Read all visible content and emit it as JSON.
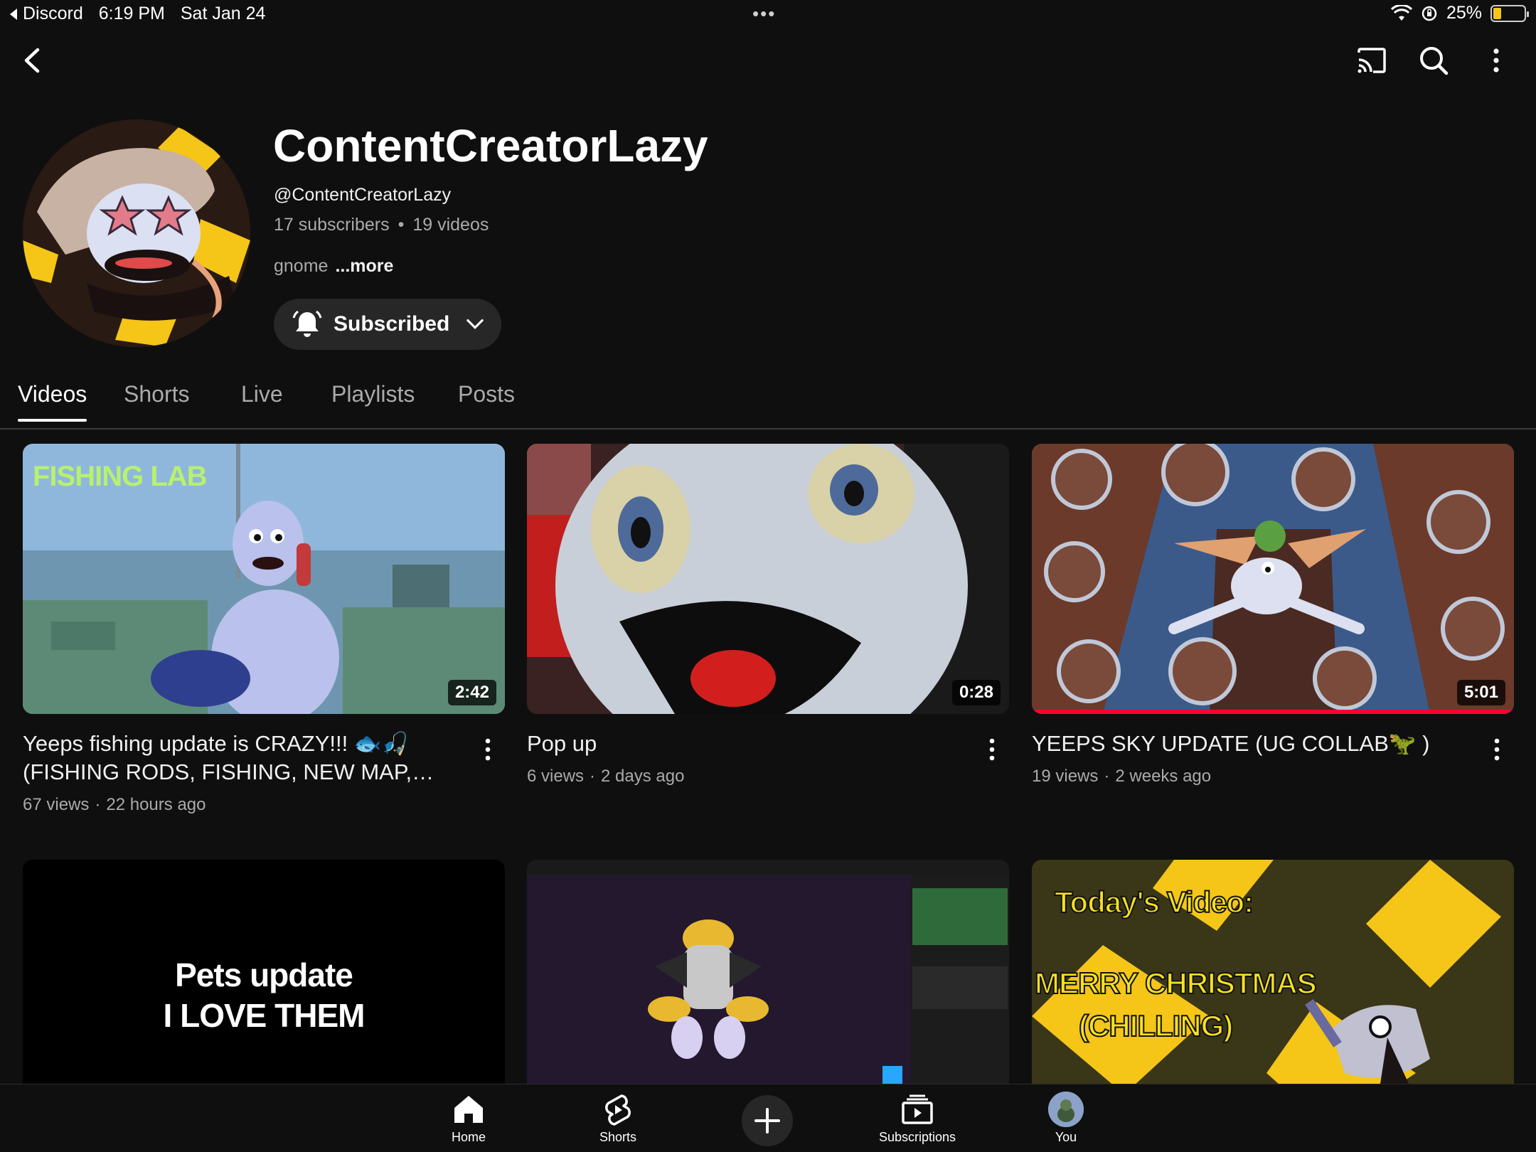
{
  "status_bar": {
    "back_app": "Discord",
    "time": "6:19 PM",
    "date": "Sat Jan 24",
    "battery": "25%",
    "battery_level": 0.25
  },
  "top_bar": {
    "icons": [
      "back-icon",
      "cast-icon",
      "search-icon",
      "more-vert-icon"
    ]
  },
  "channel": {
    "title": "ContentCreatorLazy",
    "handle": "@ContentCreatorLazy",
    "subscribers": "17 subscribers",
    "separator": "•",
    "videos": "19 videos",
    "description": "gnome",
    "more": "...more",
    "subscribe_label": "Subscribed"
  },
  "tabs": [
    {
      "label": "Videos",
      "active": true
    },
    {
      "label": "Shorts",
      "active": false
    },
    {
      "label": "Live",
      "active": false
    },
    {
      "label": "Playlists",
      "active": false
    },
    {
      "label": "Posts",
      "active": false
    }
  ],
  "videos": [
    {
      "title": "Yeeps fishing update is CRAZY!!! 🐟🎣 (FISHING RODS, FISHING, NEW MAP,…",
      "views": "67 views",
      "age": "22 hours ago",
      "duration": "2:42",
      "thumb_text": "FISHING LAB",
      "watched": 0
    },
    {
      "title": "Pop up",
      "views": "6 views",
      "age": "2 days ago",
      "duration": "0:28",
      "thumb_text": "",
      "watched": 0
    },
    {
      "title": "YEEPS SKY UPDATE (UG COLLAB🦖 )",
      "views": "19 views",
      "age": "2 weeks ago",
      "duration": "5:01",
      "thumb_text": "",
      "watched": 1.0
    },
    {
      "thumb_text_1": "Pets update",
      "thumb_text_2": "I LOVE THEM"
    },
    {},
    {
      "thumb_text_1": "Today's Video:",
      "thumb_text_2": "MERRY CHRISTMAS",
      "thumb_text_3": "(CHILLING)"
    }
  ],
  "meta_separator": "·",
  "bottom_nav": [
    {
      "label": "Home",
      "icon": "home-icon"
    },
    {
      "label": "Shorts",
      "icon": "shorts-icon"
    },
    {
      "label": "",
      "icon": "create-icon"
    },
    {
      "label": "Subscriptions",
      "icon": "subscriptions-icon"
    },
    {
      "label": "You",
      "icon": "you-avatar"
    }
  ],
  "colors": {
    "background": "#0f0f0f",
    "chip": "#272727",
    "progress": "#ff0033",
    "secondary_text": "#aaaaaa"
  }
}
